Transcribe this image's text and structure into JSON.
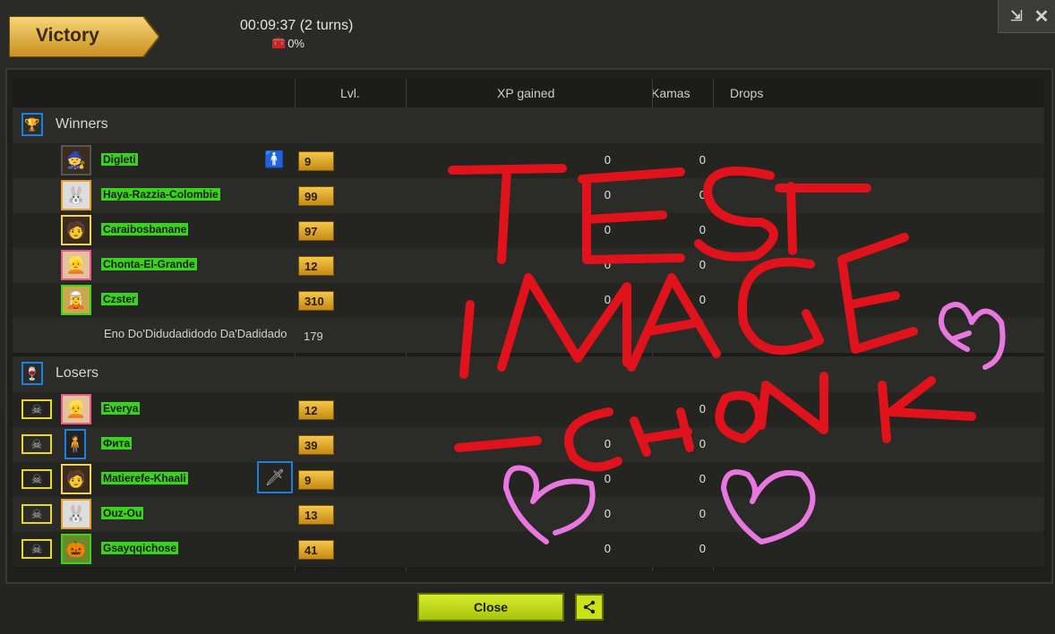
{
  "header": {
    "title": "Victory",
    "time": "00:09:37 (2 turns)",
    "chest_percent": "0%"
  },
  "columns": {
    "lvl": "Lvl.",
    "xp": "XP gained",
    "kamas": "Kamas",
    "drops": "Drops"
  },
  "sections": {
    "winners": "Winners",
    "losers": "Losers"
  },
  "winners": [
    {
      "name": "Digleti",
      "lvl": "9",
      "xp": "0",
      "kamas": "0"
    },
    {
      "name": "Haya-Razzia-Colombie",
      "lvl": "99",
      "xp": "0",
      "kamas": "0"
    },
    {
      "name": "Caraibosbanane",
      "lvl": "97",
      "xp": "0",
      "kamas": "0"
    },
    {
      "name": "Chonta-El-Grande",
      "lvl": "12",
      "xp": "0",
      "kamas": "0"
    },
    {
      "name": "Czster",
      "lvl": "310",
      "xp": "0",
      "kamas": "0"
    },
    {
      "name": "Eno Do'Didudadidodo Da'Dadidado",
      "lvl": "179",
      "xp": "",
      "kamas": ""
    }
  ],
  "losers": [
    {
      "name": "Everya",
      "lvl": "12",
      "xp": "",
      "kamas": "0"
    },
    {
      "name": "Фита",
      "lvl": "39",
      "xp": "0",
      "kamas": "0"
    },
    {
      "name": "Matierefe-Khaali",
      "lvl": "9",
      "xp": "0",
      "kamas": "0"
    },
    {
      "name": "Ouz-Ou",
      "lvl": "13",
      "xp": "0",
      "kamas": "0"
    },
    {
      "name": "Gsayqqichose",
      "lvl": "41",
      "xp": "0",
      "kamas": "0"
    }
  ],
  "footer": {
    "close_label": "Close"
  },
  "colors": {
    "name_highlight": "#39d21c",
    "level_badge": "#e0a52a",
    "close_button": "#c4de1c",
    "annotation_red": "#e0121c",
    "annotation_pink": "#e878e0"
  },
  "overlay_text": {
    "line1": "TEST",
    "line2": "IMAGE",
    "line3": "-CHONK"
  }
}
